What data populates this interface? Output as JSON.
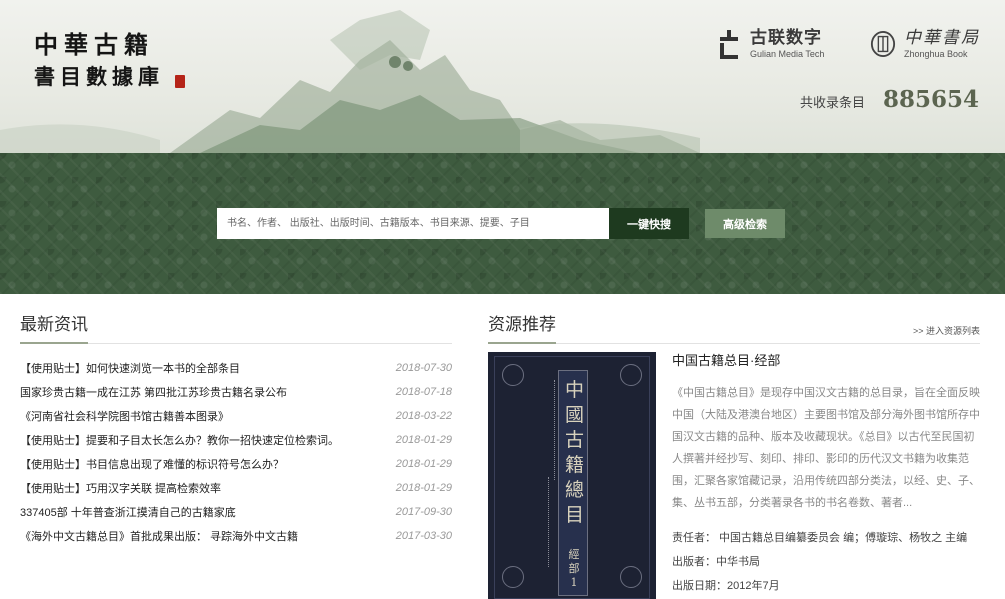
{
  "header": {
    "logo_line1": "中華古籍",
    "logo_line2": "書目數據庫",
    "partners": [
      {
        "name_cn": "古联数字",
        "name_en": "Gulian Media Tech",
        "icon": "gulian-logo-icon"
      },
      {
        "name_cn": "中華書局",
        "name_en": "Zhonghua Book",
        "icon": "zhonghua-seal-icon"
      }
    ],
    "total_label": "共收录条目",
    "total_count": "885654"
  },
  "search": {
    "placeholder": "书名、作者、 出版社、出版时间、古籍版本、书目来源、提要、子目",
    "quick_button": "一键快搜",
    "advanced_button": "高级检索"
  },
  "news": {
    "title": "最新资讯",
    "items": [
      {
        "title": "【使用贴士】如何快速浏览一本书的全部条目",
        "date": "2018-07-30"
      },
      {
        "title": "国家珍贵古籍一成在江苏 第四批江苏珍贵古籍名录公布",
        "date": "2018-07-18"
      },
      {
        "title": "《河南省社会科学院图书馆古籍善本图录》",
        "date": "2018-03-22"
      },
      {
        "title": "【使用贴士】提要和子目太长怎么办？教你一招快速定位检索词。",
        "date": "2018-01-29"
      },
      {
        "title": "【使用贴士】书目信息出现了难懂的标识符号怎么办？",
        "date": "2018-01-29"
      },
      {
        "title": "【使用贴士】巧用汉字关联 提高检索效率",
        "date": "2018-01-29"
      },
      {
        "title": "337405部 十年普查浙江摸清自己的古籍家底",
        "date": "2017-09-30"
      },
      {
        "title": "《海外中文古籍总目》首批成果出版： 寻踪海外中文古籍",
        "date": "2017-03-30"
      }
    ]
  },
  "resources": {
    "title": "资源推荐",
    "more_link": ">> 进入资源列表",
    "cover_title": "中國古籍總目",
    "cover_sub": "經部 1",
    "item_title": "中国古籍总目·经部",
    "description": "《中国古籍总目》是现存中国汉文古籍的总目录，旨在全面反映中国（大陆及港澳台地区）主要图书馆及部分海外图书馆所存中国汉文古籍的品种、版本及收藏现状。《总目》以古代至民国初人撰著并经抄写、刻印、排印、影印的历代汉文书籍为收集范围，汇聚各家馆藏记录，沿用传统四部分类法，以经、史、子、集、丛书五部，分类著录各书的书名卷数、著者...",
    "author_line": "责任者： 中国古籍总目编纂委员会 编；傅璇琮、杨牧之 主编",
    "publisher_line": "出版者：中华书局",
    "date_line": "出版日期：2012年7月"
  },
  "colors": {
    "band_green": "#3e5b3f",
    "search_button": "#1e3a1f",
    "advanced_button": "#6e8b6a"
  }
}
